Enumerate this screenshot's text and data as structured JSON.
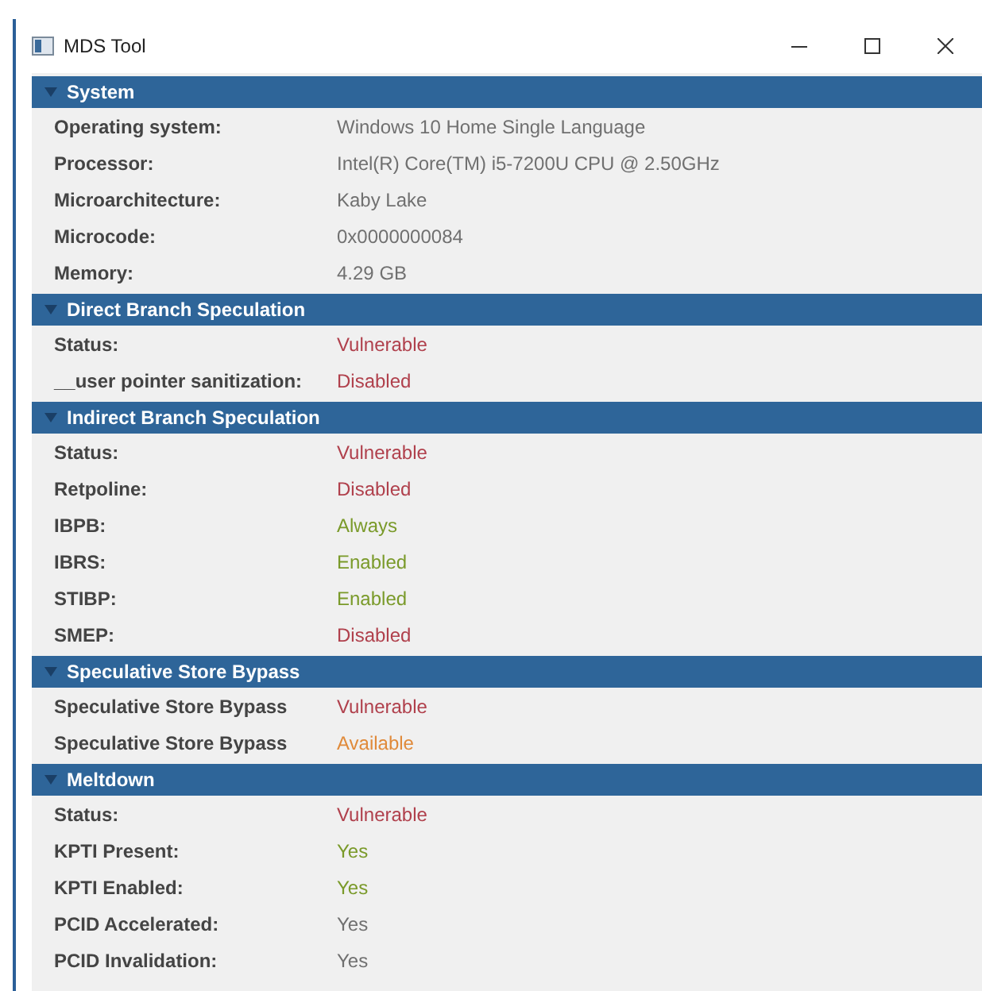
{
  "window": {
    "title": "MDS Tool"
  },
  "sections": [
    {
      "title": "System",
      "expanded": true,
      "rows": [
        {
          "label": "Operating system:",
          "value": "Windows 10 Home Single Language",
          "color": "#707070"
        },
        {
          "label": "Processor:",
          "value": "Intel(R) Core(TM) i5-7200U CPU @ 2.50GHz",
          "color": "#707070"
        },
        {
          "label": "Microarchitecture:",
          "value": "Kaby Lake",
          "color": "#707070"
        },
        {
          "label": "Microcode:",
          "value": "0x0000000084",
          "color": "#707070"
        },
        {
          "label": "Memory:",
          "value": "4.29 GB",
          "color": "#707070"
        }
      ]
    },
    {
      "title": "Direct Branch Speculation",
      "expanded": true,
      "rows": [
        {
          "label": "Status:",
          "value": "Vulnerable",
          "color": "#b0404c"
        },
        {
          "label": "__user pointer sanitization:",
          "value": "Disabled",
          "color": "#b0404c"
        }
      ]
    },
    {
      "title": "Indirect Branch Speculation",
      "expanded": true,
      "rows": [
        {
          "label": "Status:",
          "value": "Vulnerable",
          "color": "#b0404c"
        },
        {
          "label": "Retpoline:",
          "value": "Disabled",
          "color": "#b0404c"
        },
        {
          "label": "IBPB:",
          "value": "Always",
          "color": "#7a9a2a"
        },
        {
          "label": "IBRS:",
          "value": "Enabled",
          "color": "#7a9a2a"
        },
        {
          "label": "STIBP:",
          "value": "Enabled",
          "color": "#7a9a2a"
        },
        {
          "label": "SMEP:",
          "value": "Disabled",
          "color": "#b0404c"
        }
      ]
    },
    {
      "title": "Speculative Store Bypass",
      "expanded": true,
      "rows": [
        {
          "label": "Speculative Store Bypass",
          "value": "Vulnerable",
          "color": "#b0404c"
        },
        {
          "label": "Speculative Store Bypass",
          "value": "Available",
          "color": "#e08a3a"
        }
      ]
    },
    {
      "title": "Meltdown",
      "expanded": true,
      "rows": [
        {
          "label": "Status:",
          "value": "Vulnerable",
          "color": "#b0404c"
        },
        {
          "label": "KPTI Present:",
          "value": "Yes",
          "color": "#7a9a2a"
        },
        {
          "label": "KPTI Enabled:",
          "value": "Yes",
          "color": "#7a9a2a"
        },
        {
          "label": "PCID Accelerated:",
          "value": "Yes",
          "color": "#707070"
        },
        {
          "label": "PCID Invalidation:",
          "value": "Yes",
          "color": "#707070"
        }
      ]
    }
  ]
}
